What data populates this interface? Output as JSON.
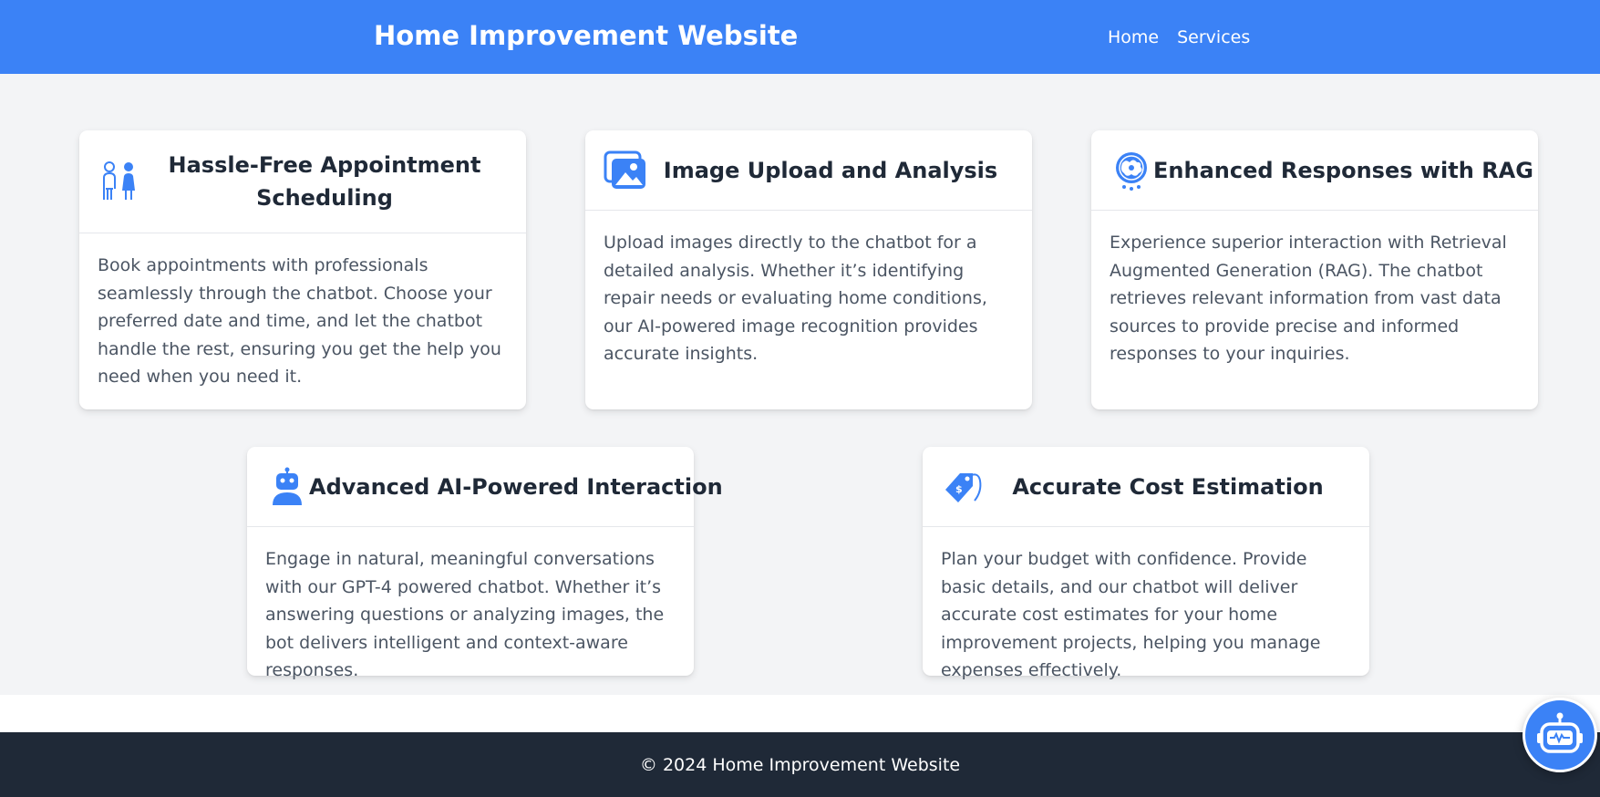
{
  "header": {
    "title": "Home Improvement Website",
    "nav": [
      "Home",
      "Services"
    ]
  },
  "features": [
    {
      "icon": "people-icon",
      "title": "Hassle-Free Appointment Scheduling",
      "description": "Book appointments with professionals seamlessly through the chatbot. Choose your preferred date and time, and let the chatbot handle the rest, ensuring you get the help you need when you need it."
    },
    {
      "icon": "image-icon",
      "title": "Image Upload and Analysis",
      "description": "Upload images directly to the chatbot for a detailed analysis. Whether it’s identifying repair needs or evaluating home conditions, our AI-powered image recognition provides accurate insights."
    },
    {
      "icon": "globe-brain-icon",
      "title": "Enhanced Responses with RAG",
      "description": "Experience superior interaction with Retrieval Augmented Generation (RAG). The chatbot retrieves relevant information from vast data sources to provide precise and informed responses to your inquiries."
    },
    {
      "icon": "robot-icon",
      "title": "Advanced AI-Powered Interaction",
      "description": "Engage in natural, meaningful conversations with our GPT-4 powered chatbot. Whether it’s answering questions or analyzing images, the bot delivers intelligent and context-aware responses."
    },
    {
      "icon": "price-tag-icon",
      "title": "Accurate Cost Estimation",
      "description": "Plan your budget with confidence. Provide basic details, and our chatbot will deliver accurate cost estimates for your home improvement projects, helping you manage expenses effectively."
    }
  ],
  "footer": {
    "text": "© 2024 Home Improvement Website"
  },
  "chat_button": {
    "icon": "chatbot-icon"
  },
  "colors": {
    "primary": "#3b82f6",
    "background": "#f3f4f6",
    "footer": "#1f2937"
  }
}
